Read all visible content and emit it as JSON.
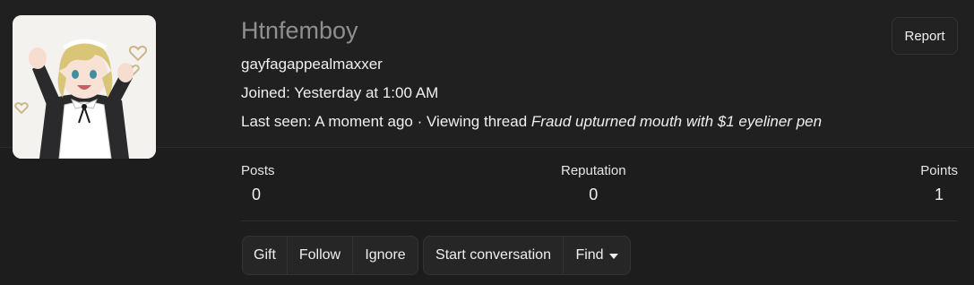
{
  "profile": {
    "username": "Htnfemboy",
    "user_title": "gayfagappealmaxxer",
    "joined_label": "Joined:",
    "joined_value": "Yesterday at 1:00 AM",
    "last_seen_label": "Last seen:",
    "last_seen_value": "A moment ago",
    "separator": "·",
    "activity_prefix": "Viewing thread",
    "activity_thread": "Fraud upturned mouth with $1 eyeliner pen",
    "avatar_icon": "avatar-illustration-icon"
  },
  "actions": {
    "report_label": "Report"
  },
  "stats": {
    "posts_label": "Posts",
    "posts_value": "0",
    "reputation_label": "Reputation",
    "reputation_value": "0",
    "points_label": "Points",
    "points_value": "1"
  },
  "buttons": {
    "gift": "Gift",
    "follow": "Follow",
    "ignore": "Ignore",
    "start_conversation": "Start conversation",
    "find": "Find"
  },
  "colors": {
    "background": "#1d1d1d",
    "header_band": "#202020",
    "username": "#8f8f8f",
    "text": "#efefef"
  }
}
